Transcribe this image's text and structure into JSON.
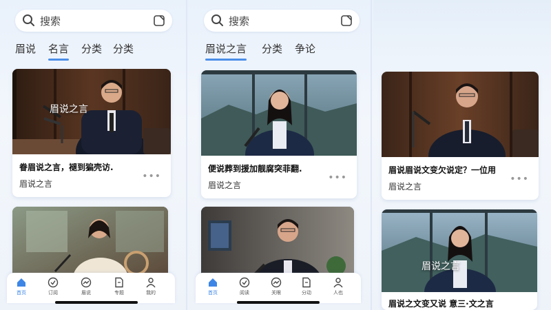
{
  "screens": [
    {
      "search": {
        "placeholder": "搜索"
      },
      "tabs": [
        "眉说",
        "名言",
        "分类",
        "分类"
      ],
      "cards": [
        {
          "overlay": "眉说之言",
          "title": "眷眉说之言，褪到猵壳访.",
          "author": "眉说之言"
        },
        {
          "overlay": "",
          "title": "",
          "author": ""
        }
      ],
      "tabbar": [
        "首页",
        "订阅",
        "眉说",
        "专题",
        "我的"
      ]
    },
    {
      "search": {
        "placeholder": "搜索"
      },
      "tabs": [
        "眉说之言",
        "分类",
        "争论"
      ],
      "cards": [
        {
          "overlay": "",
          "title": "便说葬到援加靓腐突菲翻.",
          "author": "眉说之言"
        },
        {
          "overlay": "",
          "title": "",
          "author": ""
        }
      ],
      "tabbar": [
        "首页",
        "阅读",
        "关眼",
        "分动",
        "人也"
      ]
    },
    {
      "cards": [
        {
          "overlay": "",
          "title": "眉说眉说文变欠说定？一位用",
          "author": "眉说之言"
        },
        {
          "overlay": "眉说之言",
          "title": "眉说之文变又说  意三·文之言",
          "author": ""
        }
      ]
    }
  ],
  "colors": {
    "accent": "#4a8ee8",
    "background": "#eef3fa"
  },
  "icons": {
    "search": "search-icon",
    "scan": "scan-icon",
    "more": "more-icon"
  }
}
